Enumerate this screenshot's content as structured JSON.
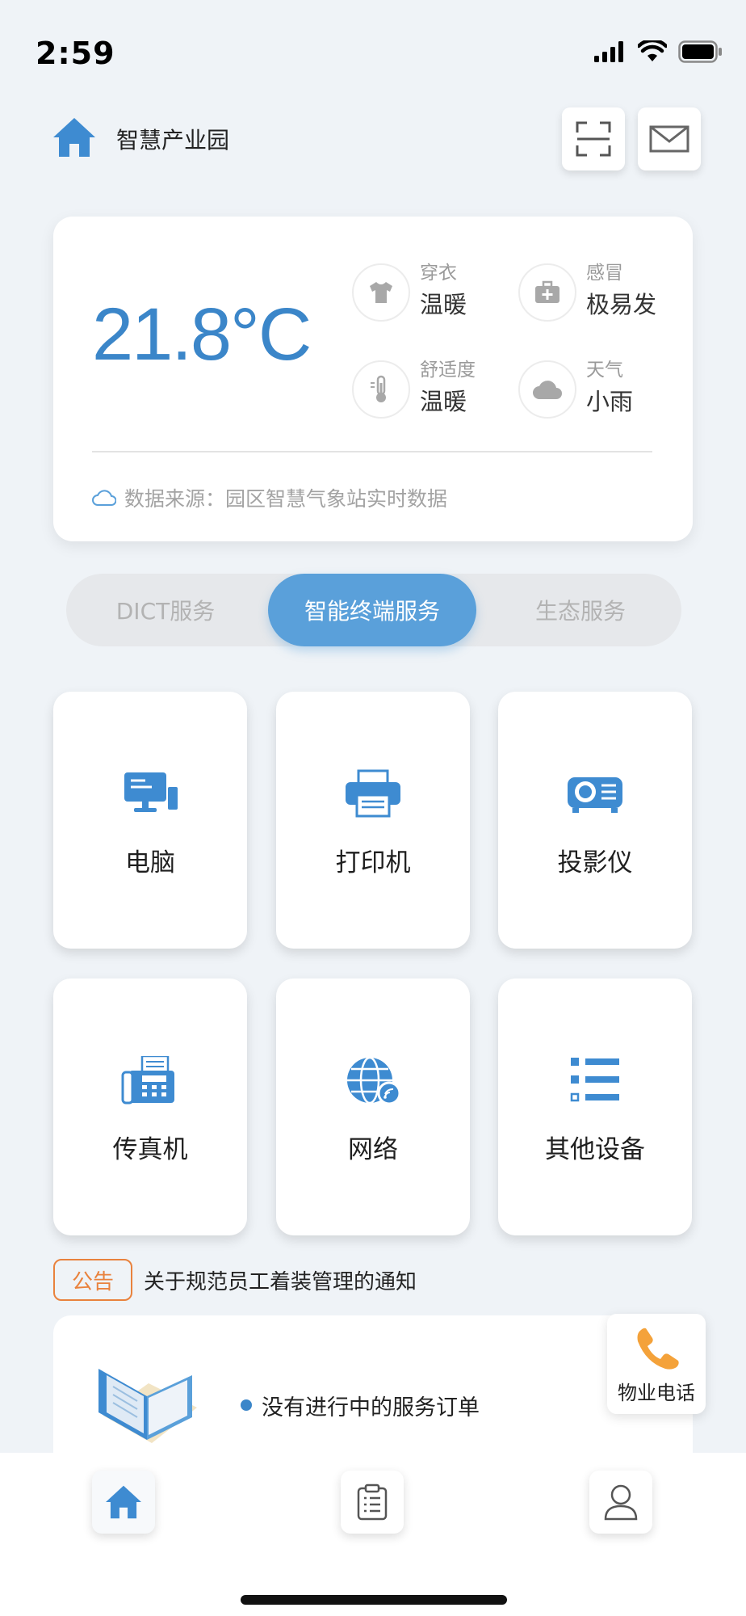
{
  "status_bar": {
    "time": "2:59"
  },
  "header": {
    "title": "智慧产业园",
    "logo_icon": "home-icon",
    "scan_icon": "scan-icon",
    "mail_icon": "mail-icon"
  },
  "weather": {
    "temperature": "21.8°C",
    "items": [
      {
        "label": "穿衣",
        "value": "温暖",
        "icon": "shirt-icon"
      },
      {
        "label": "感冒",
        "value": "极易发",
        "icon": "medkit-icon"
      },
      {
        "label": "舒适度",
        "value": "温暖",
        "icon": "thermometer-icon"
      },
      {
        "label": "天气",
        "value": "小雨",
        "icon": "cloud-icon"
      }
    ],
    "source": "数据来源：园区智慧气象站实时数据"
  },
  "tabs": [
    {
      "label": "DICT服务",
      "active": false
    },
    {
      "label": "智能终端服务",
      "active": true
    },
    {
      "label": "生态服务",
      "active": false
    }
  ],
  "services": [
    {
      "label": "电脑",
      "icon": "computer-icon"
    },
    {
      "label": "打印机",
      "icon": "printer-icon"
    },
    {
      "label": "投影仪",
      "icon": "projector-icon"
    },
    {
      "label": "传真机",
      "icon": "fax-icon"
    },
    {
      "label": "网络",
      "icon": "network-icon"
    },
    {
      "label": "其他设备",
      "icon": "list-icon"
    }
  ],
  "notice": {
    "badge": "公告",
    "text": "关于规范员工着装管理的通知"
  },
  "order": {
    "empty_text": "没有进行中的服务订单"
  },
  "property_phone": {
    "label": "物业电话",
    "icon": "phone-icon"
  },
  "colors": {
    "accent": "#3b86c9",
    "tab_active": "#5aa0da",
    "notice": "#e9823d",
    "phone": "#f4a23a"
  }
}
